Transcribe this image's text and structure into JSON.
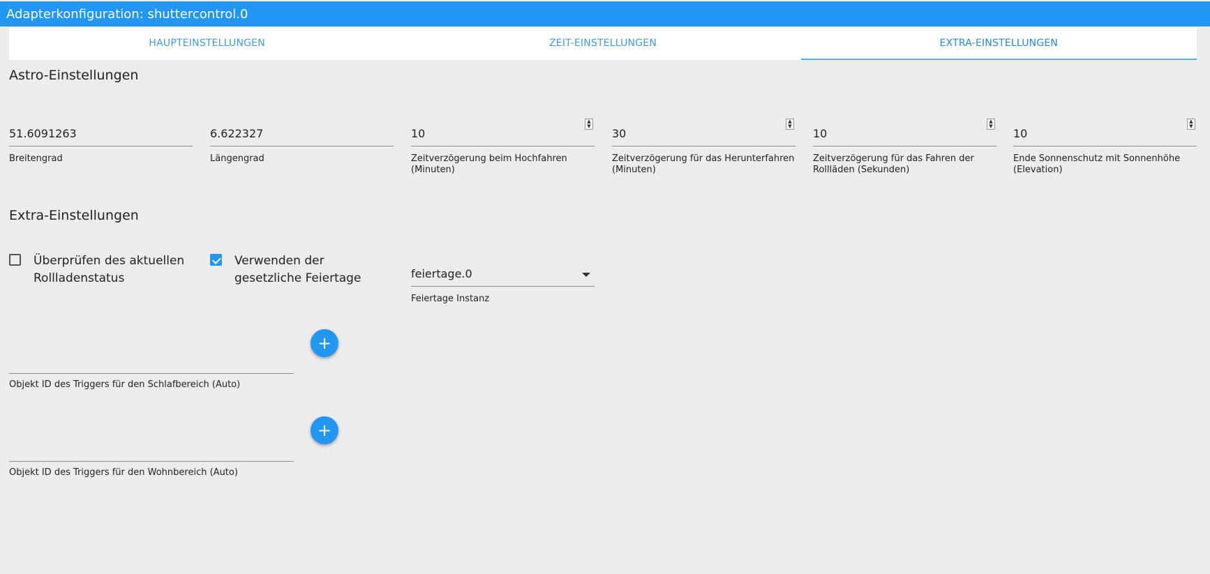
{
  "window": {
    "title": "Adapterkonfiguration: shuttercontrol.0"
  },
  "tabs": [
    {
      "label": "HAUPTEINSTELLUNGEN"
    },
    {
      "label": "ZEIT-EINSTELLUNGEN"
    },
    {
      "label": "EXTRA-EINSTELLUNGEN"
    }
  ],
  "active_tab": "EXTRA-EINSTELLUNGEN",
  "astro": {
    "title": "Astro-Einstellungen",
    "latitude": {
      "value": "51.6091263",
      "label": "Breitengrad"
    },
    "longitude": {
      "value": "6.622327",
      "label": "Längengrad"
    },
    "delay_up": {
      "value": "10",
      "label": "Zeitverzögerung beim Hochfahren (Minuten)"
    },
    "delay_down": {
      "value": "30",
      "label": "Zeitverzögerung für das Herunterfahren (Minuten)"
    },
    "delay_drive": {
      "value": "10",
      "label": "Zeitverzögerung für das Fahren der Rollläden (Sekunden)"
    },
    "sun_end": {
      "value": "10",
      "label": "Ende Sonnenschutz mit Sonnenhöhe (Elevation)"
    }
  },
  "extra": {
    "title": "Extra-Einstellungen",
    "check_status": {
      "label": "Überprüfen des aktuellen Rollladenstatus",
      "checked": false
    },
    "use_holidays": {
      "label": "Verwenden der gesetzliche Feiertage",
      "checked": true
    },
    "holiday_instance": {
      "value": "feiertage.0",
      "label": "Feiertage Instanz"
    },
    "trigger_sleep": {
      "value": "",
      "label": "Objekt ID des Triggers für den Schlafbereich (Auto)"
    },
    "trigger_living": {
      "value": "",
      "label": "Objekt ID des Triggers für den Wohnbereich (Auto)"
    },
    "add_icon": "+"
  },
  "colors": {
    "accent": "#2196f3",
    "background": "#ececec"
  }
}
